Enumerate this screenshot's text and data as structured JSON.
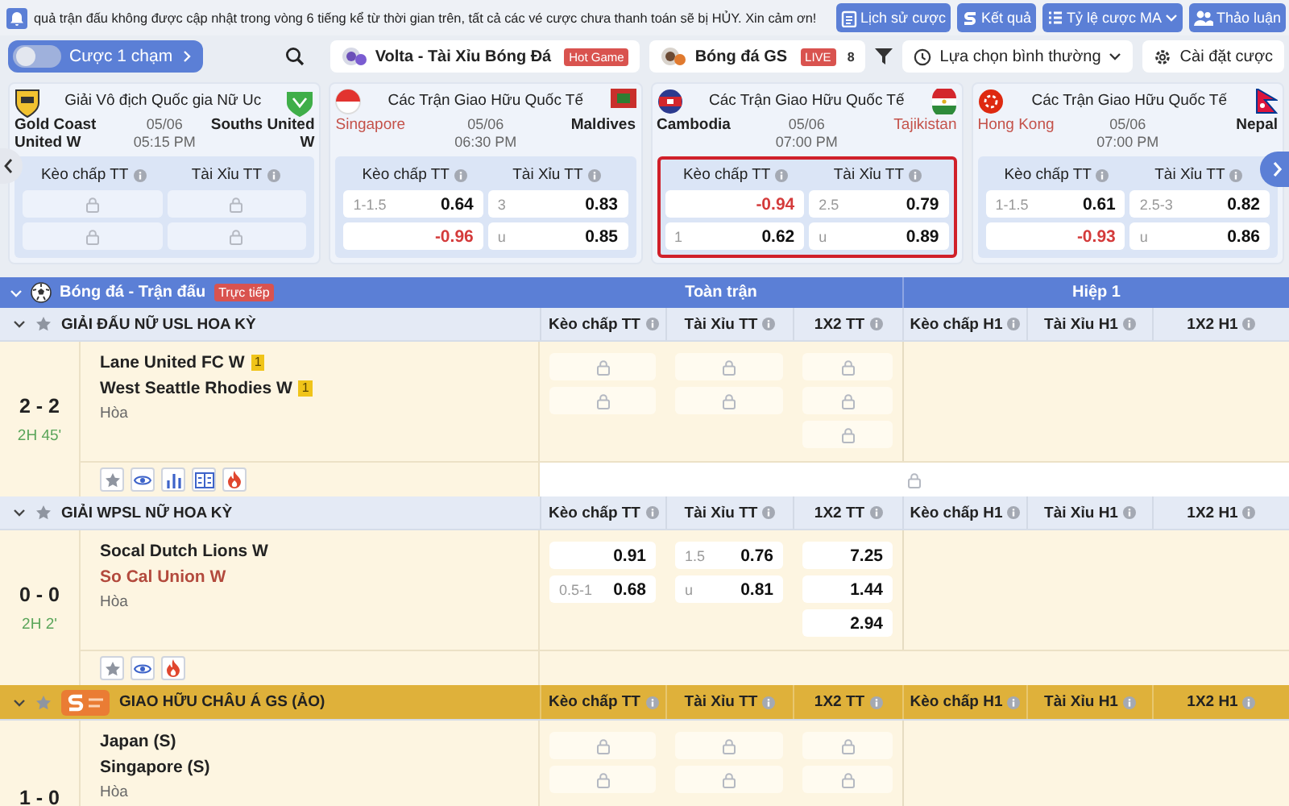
{
  "notice": {
    "text": "quả trận đấu không được cập nhật trong vòng 6 tiếng kể từ thời gian trên, tất cả các vé cược chưa thanh toán sẽ bị HỦY. Xin cảm ơn!"
  },
  "top_buttons": [
    {
      "label": "Lịch sử cược",
      "dropdown": false
    },
    {
      "label": "Kết quả",
      "dropdown": false
    },
    {
      "label": "Tỷ lệ cược MA",
      "dropdown": true
    },
    {
      "label": "Thảo luận",
      "dropdown": false
    }
  ],
  "toolbar": {
    "one_click": {
      "label": "Cược 1 chạm",
      "on": false
    },
    "tabs": [
      {
        "label": "Volta - Tài Xỉu Bóng Đá",
        "badge": "Hot Game",
        "selected": false
      },
      {
        "label": "Bóng đá GS",
        "badge": "LIVE",
        "count": "8",
        "selected": false
      }
    ],
    "view_select": {
      "value": "Lựa chọn bình thường"
    },
    "settings": {
      "label": "Cài đặt cược"
    }
  },
  "featured_matches": [
    {
      "league": "Giải Vô địch Quốc gia Nữ Uc",
      "home": {
        "name": "Gold Coast United W",
        "highlighted": false
      },
      "away": {
        "name": "Souths United W",
        "highlighted": false
      },
      "date": "05/06",
      "time": "05:15 PM",
      "highlighted": false,
      "odds_headers": [
        "Kèo chấp TT",
        "Tài Xỉu TT"
      ],
      "odds": [
        [
          {
            "locked": true
          },
          {
            "locked": true
          }
        ],
        [
          {
            "locked": true
          },
          {
            "locked": true
          }
        ]
      ]
    },
    {
      "league": "Các Trận Giao Hữu Quốc Tế",
      "home": {
        "name": "Singapore",
        "highlighted": true
      },
      "away": {
        "name": "Maldives",
        "highlighted": false
      },
      "date": "05/06",
      "time": "06:30 PM",
      "highlighted": false,
      "odds_headers": [
        "Kèo chấp TT",
        "Tài Xỉu TT"
      ],
      "odds": [
        [
          {
            "locked": false,
            "line": "1-1.5",
            "value": "0.64",
            "negative": false
          },
          {
            "locked": false,
            "line": "3",
            "value": "0.83",
            "negative": false
          }
        ],
        [
          {
            "locked": false,
            "value": "-0.96",
            "negative": true
          },
          {
            "locked": false,
            "line": "u",
            "value": "0.85",
            "negative": false
          }
        ]
      ]
    },
    {
      "league": "Các Trận Giao Hữu Quốc Tế",
      "home": {
        "name": "Cambodia",
        "highlighted": false
      },
      "away": {
        "name": "Tajikistan",
        "highlighted": true
      },
      "date": "05/06",
      "time": "07:00 PM",
      "highlighted": true,
      "odds_headers": [
        "Kèo chấp TT",
        "Tài Xỉu TT"
      ],
      "odds": [
        [
          {
            "locked": false,
            "value": "-0.94",
            "negative": true
          },
          {
            "locked": false,
            "line": "2.5",
            "value": "0.79",
            "negative": false
          }
        ],
        [
          {
            "locked": false,
            "line": "1",
            "value": "0.62",
            "negative": false
          },
          {
            "locked": false,
            "line": "u",
            "value": "0.89",
            "negative": false
          }
        ]
      ]
    },
    {
      "league": "Các Trận Giao Hữu Quốc Tế",
      "home": {
        "name": "Hong Kong",
        "highlighted": true
      },
      "away": {
        "name": "Nepal",
        "highlighted": false
      },
      "date": "05/06",
      "time": "07:00 PM",
      "highlighted": false,
      "odds_headers": [
        "Kèo chấp TT",
        "Tài Xỉu TT"
      ],
      "odds": [
        [
          {
            "locked": false,
            "line": "1-1.5",
            "value": "0.61",
            "negative": false
          },
          {
            "locked": false,
            "line": "2.5-3",
            "value": "0.82",
            "negative": false
          }
        ],
        [
          {
            "locked": false,
            "value": "-0.93",
            "negative": true
          },
          {
            "locked": false,
            "line": "u",
            "value": "0.86",
            "negative": false
          }
        ]
      ]
    }
  ],
  "sport_section": {
    "title": "Bóng đá - Trận đấu",
    "badge": "Trực tiếp",
    "expanded": true,
    "column_groups": [
      "Toàn trận",
      "Hiệp 1"
    ]
  },
  "leagues": [
    {
      "kind": "standard",
      "name": "GIẢI ĐẤU NỮ USL HOA KỲ",
      "starred": false,
      "expanded": true,
      "columns": [
        "Kèo chấp TT",
        "Tài Xỉu TT",
        "1X2 TT",
        "Kèo chấp H1",
        "Tài Xỉu H1",
        "1X2 H1"
      ],
      "matches": [
        {
          "score": "2 - 2",
          "clock": "2H 45'",
          "home": {
            "name": "Lane United FC W",
            "cards": "1",
            "highlighted": false
          },
          "away": {
            "name": "West Seattle Rhodies W",
            "cards": "1",
            "highlighted": false
          },
          "draw": "Hòa",
          "handicap": [
            {
              "locked": true
            },
            {
              "locked": true
            }
          ],
          "over_under": [
            {
              "locked": true
            },
            {
              "locked": true
            }
          ],
          "result_1x2": [
            {
              "locked": true
            },
            {
              "locked": true
            },
            {
              "locked": true
            }
          ],
          "more_locked": true,
          "actions": [
            {
              "kind": "favorite"
            },
            {
              "kind": "watch"
            },
            {
              "kind": "stats"
            },
            {
              "kind": "scoreboard"
            },
            {
              "kind": "hot"
            }
          ]
        }
      ]
    },
    {
      "kind": "standard",
      "name": "GIẢI WPSL NỮ HOA KỲ",
      "starred": false,
      "expanded": true,
      "columns": [
        "Kèo chấp TT",
        "Tài Xỉu TT",
        "1X2 TT",
        "Kèo chấp H1",
        "Tài Xỉu H1",
        "1X2 H1"
      ],
      "matches": [
        {
          "score": "0 - 0",
          "clock": "2H 2'",
          "home": {
            "name": "Socal Dutch Lions W",
            "highlighted": false
          },
          "away": {
            "name": "So Cal Union W",
            "highlighted": true
          },
          "draw": "Hòa",
          "handicap": [
            {
              "locked": false,
              "value": "0.91",
              "negative": false
            },
            {
              "locked": false,
              "line": "0.5-1",
              "value": "0.68",
              "negative": false
            }
          ],
          "over_under": [
            {
              "locked": false,
              "line": "1.5",
              "value": "0.76",
              "negative": false
            },
            {
              "locked": false,
              "line": "u",
              "value": "0.81",
              "negative": false
            }
          ],
          "result_1x2": [
            {
              "locked": false,
              "value": "7.25",
              "negative": false
            },
            {
              "locked": false,
              "value": "1.44",
              "negative": false
            },
            {
              "locked": false,
              "value": "2.94",
              "negative": false
            }
          ],
          "more_locked": false,
          "actions": [
            {
              "kind": "favorite"
            },
            {
              "kind": "watch"
            },
            {
              "kind": "hot"
            }
          ]
        }
      ]
    },
    {
      "kind": "featured",
      "name": "GIAO HỮU CHÂU Á GS (ẢO)",
      "starred": false,
      "expanded": true,
      "columns": [
        "Kèo chấp TT",
        "Tài Xỉu TT",
        "1X2 TT",
        "Kèo chấp H1",
        "Tài Xỉu H1",
        "1X2 H1"
      ],
      "matches": [
        {
          "score": "1 - 0",
          "home": {
            "name": "Japan (S)",
            "highlighted": false
          },
          "away": {
            "name": "Singapore (S)",
            "highlighted": false
          },
          "draw": "Hòa",
          "handicap": [
            {
              "locked": true
            },
            {
              "locked": true
            }
          ],
          "over_under": [
            {
              "locked": true
            },
            {
              "locked": true
            }
          ],
          "result_1x2": [
            {
              "locked": true
            },
            {
              "locked": true
            }
          ]
        }
      ]
    }
  ]
}
